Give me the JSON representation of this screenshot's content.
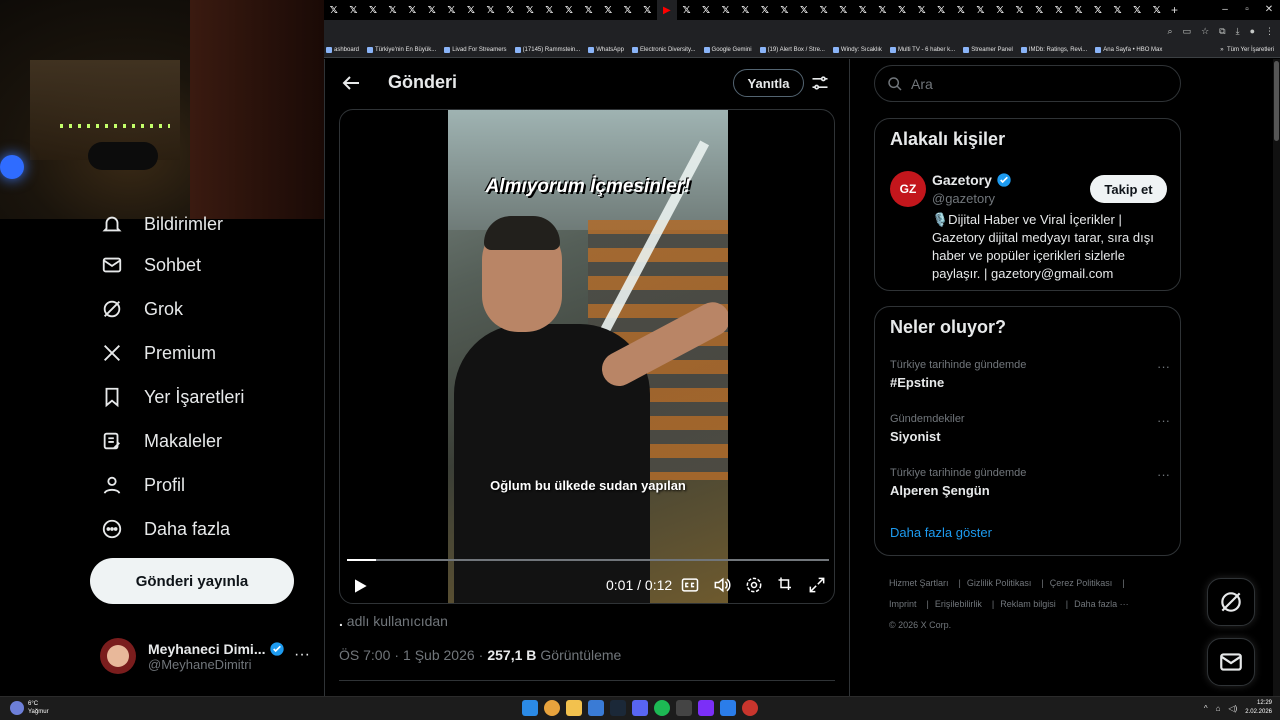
{
  "browser": {
    "bookmarks": [
      "ashboard",
      "Türkiye'nin En Büyük...",
      "Livad For Streamers",
      "(17145) Rammstein...",
      "WhatsApp",
      "Electronic Diversity...",
      "Google Gemini",
      "(19) Alert Box / Stre...",
      "Windy: Sıcaklık",
      "Multi TV - 6 haber k...",
      "Streamer Panel",
      "IMDb: Ratings, Revi...",
      "Ana Sayfa • HBO Max"
    ],
    "bookmarks_overflow": "»",
    "all_bookmarks": "Tüm Yer İşaretleri",
    "new_tab": "+"
  },
  "nav": {
    "partial_item": "Bildirimler",
    "items": [
      {
        "label": "Sohbet",
        "icon": "mail-icon"
      },
      {
        "label": "Grok",
        "icon": "grok-icon"
      },
      {
        "label": "Premium",
        "icon": "x-logo-icon"
      },
      {
        "label": "Yer İşaretleri",
        "icon": "bookmark-icon"
      },
      {
        "label": "Makaleler",
        "icon": "article-icon"
      },
      {
        "label": "Profil",
        "icon": "person-icon"
      },
      {
        "label": "Daha fazla",
        "icon": "more-circle-icon"
      }
    ],
    "post_button": "Gönderi yayınla",
    "account": {
      "name": "Meyhaneci Dimi...",
      "handle": "@MeyhaneDimitri",
      "more": "···"
    }
  },
  "post": {
    "title": "Gönderi",
    "reply_button": "Yanıtla",
    "video": {
      "overlay_title": "Almıyorum İçmesinler!",
      "subtitle": "Oğlum bu ülkede sudan yapılan",
      "time": "0:01 / 0:12",
      "progress": 0.06
    },
    "by_prefix": ".",
    "by_text": " adlı kullanıcıdan",
    "time": "ÖS 7:00",
    "dot": "·",
    "date": "1 Şub 2026",
    "views": "257,1 B",
    "views_label": "Görüntüleme"
  },
  "sidebar": {
    "search_placeholder": "Ara",
    "related": {
      "title": "Alakalı kişiler",
      "avatar_text": "GZ",
      "name": "Gazetory",
      "handle": "@gazetory",
      "follow": "Takip et",
      "bio": "🎙️Dijital Haber ve Viral İçerikler | Gazetory dijital medyayı tarar, sıra dışı haber ve popüler içerikleri sizlerle paylaşır. | gazetory@gmail.com"
    },
    "trends": {
      "title": "Neler oluyor?",
      "items": [
        {
          "context": "Türkiye tarihinde gündemde",
          "name": "#Epstine"
        },
        {
          "context": "Gündemdekiler",
          "name": "Siyonist"
        },
        {
          "context": "Türkiye tarihinde gündemde",
          "name": "Alperen Şengün"
        }
      ],
      "more": "···",
      "show_more": "Daha fazla göster"
    },
    "footer": {
      "links_row1": [
        "Hizmet Şartları",
        "Gizlilik Politikası",
        "Çerez Politikası"
      ],
      "links_row2": [
        "Imprint",
        "Erişilebilirlik",
        "Reklam bilgisi",
        "Daha fazla ···"
      ],
      "copyright": "© 2026 X Corp."
    }
  },
  "taskbar": {
    "temp": "6°C",
    "weather": "Yağmur",
    "time": "12:29",
    "date": "2.02.2026"
  },
  "colors": {
    "accent": "#1d9bf0",
    "verified": "#1d9bf0",
    "text": "#e7e9ea",
    "muted": "#71767b"
  }
}
